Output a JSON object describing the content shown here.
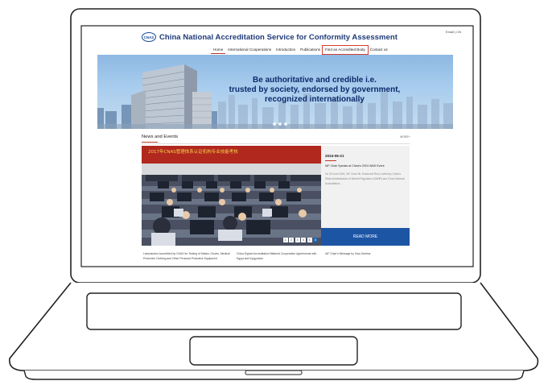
{
  "header": {
    "top_links": "Email  |  CN",
    "logo_text": "CNAS",
    "site_title": "China National Accreditation Service for Conformity Assessment"
  },
  "nav": {
    "items": [
      {
        "label": "Home"
      },
      {
        "label": "International Cooperations"
      },
      {
        "label": "Introduction"
      },
      {
        "label": "Publications"
      },
      {
        "label": "Find an Accredited Body"
      },
      {
        "label": "Contact us"
      }
    ]
  },
  "banner": {
    "line1": "Be authoritative and credible i.e.",
    "line2": "trusted by society, endorsed by government,",
    "line3": "recognized internationally"
  },
  "news": {
    "section_title": "News and Events",
    "more_label": "MORE+",
    "photo_banner_text": "2017年CNAS管理体系认证机构专业技能考核",
    "pager": [
      "1",
      "2",
      "3",
      "4",
      "5",
      "6"
    ],
    "featured": {
      "date": "2024-06-21",
      "headline": "IAF Chair Speaks at China's 2024 WAD Event",
      "summary": "On 26 June 2024, IAF Chair Mr. Emanuele Riva, invited by China's State Administration of Market Regulation (SAMR) and China National Accreditation ..."
    },
    "read_more": "READ MORE",
    "captions": [
      "Laboratories Accredited by CNAS for Testing of Masks, Gloves, Medical Protective Clothing and Other Personal Protective Equipment",
      "China Signed Accreditation Bilateral Cooperation Agreements with Egypt and Kyrgyzstan",
      "IAF Chair's Message by Xiao Jianhua"
    ]
  },
  "colors": {
    "brand_blue": "#1e3a78",
    "read_more_blue": "#1d55a5",
    "highlight_red": "#d73d2d"
  }
}
